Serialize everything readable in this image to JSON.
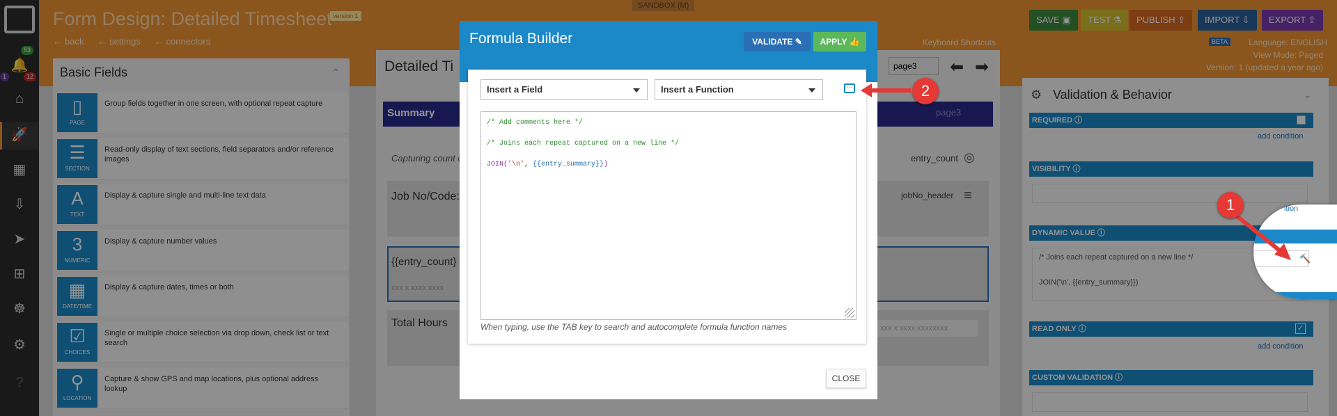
{
  "header": {
    "title": "Form Design: Detailed Timesheet",
    "version": "version 1",
    "links": [
      "back",
      "settings",
      "connectors"
    ],
    "sandbox": "SANDBOX",
    "sandbox_suffix": "(M)",
    "buttons": {
      "save": "SAVE",
      "test": "TEST",
      "publish": "PUBLISH",
      "import": "IMPORT",
      "export": "EXPORT"
    },
    "keyboard_shortcuts": "Keyboard Shortcuts",
    "beta": "BETA",
    "language": "Language: ENGLISH",
    "view_mode": "View Mode: Paged",
    "version_info": "Version: 1 (updated a year ago)"
  },
  "sidebar": {
    "badges": {
      "green": "53",
      "purple": "1",
      "red": "12"
    }
  },
  "basic_fields": {
    "title": "Basic Fields",
    "items": [
      {
        "label": "PAGE",
        "desc": "Group fields together in one screen, with optional repeat capture"
      },
      {
        "label": "SECTION",
        "desc": "Read-only display of text sections, field separators and/or reference images"
      },
      {
        "label": "TEXT",
        "desc": "Display & capture single and multi-line text data"
      },
      {
        "label": "NUMERIC",
        "desc": "Display & capture number values"
      },
      {
        "label": "DATE/TIME",
        "desc": "Display & capture dates, times or both"
      },
      {
        "label": "CHOICES",
        "desc": "Single or multiple choice selection via drop down, check list or text search"
      },
      {
        "label": "LOCATION",
        "desc": "Capture & show GPS and map locations, plus optional address lookup"
      }
    ]
  },
  "canvas": {
    "title": "Detailed Ti",
    "page_select": "page3",
    "summary": "Summary",
    "page_tag": "page3",
    "capturing": "Capturing count o",
    "entry_count": "entry_count",
    "job_no": "Job No/Code:",
    "job_no_header": "jobNo_header",
    "entry_count_field": "{{entry_count}",
    "entry_placeholder": "xxx x xxxx xxxx",
    "total_hours": "Total Hours",
    "total_placeholder": "xxx x xxxx xxxxxxxx"
  },
  "validation": {
    "title": "Validation & Behavior",
    "required": "REQUIRED",
    "add_condition": "add condition",
    "visibility": "VISIBILITY",
    "dynamic_value": "DYNAMIC VALUE",
    "dv_line1": "/* Joins each repeat captured on a new line */",
    "dv_line2": "JOIN('\\n', {{entry_summary}})",
    "read_only": "READ ONLY",
    "custom_validation": "CUSTOM VALIDATION",
    "partial_link": "ition"
  },
  "modal": {
    "title": "Formula Builder",
    "validate": "VALIDATE",
    "apply": "APPLY",
    "insert_field": "Insert a Field",
    "insert_function": "Insert a Function",
    "code": [
      "/* Add comments here */",
      "/* Joins each repeat captured on a new line */",
      "JOIN(",
      "'\\n'",
      ", ",
      "{{entry_summary}}",
      ")"
    ],
    "hint": "When typing, use the TAB key to search and autocomplete formula function names",
    "close": "CLOSE"
  },
  "markers": {
    "one": "1",
    "two": "2"
  },
  "colors": {
    "orange": "#f09433",
    "blue": "#1b88c8",
    "sidebar": "#2c2c2c",
    "red_marker": "#e53935",
    "green": "#5cb85c"
  }
}
